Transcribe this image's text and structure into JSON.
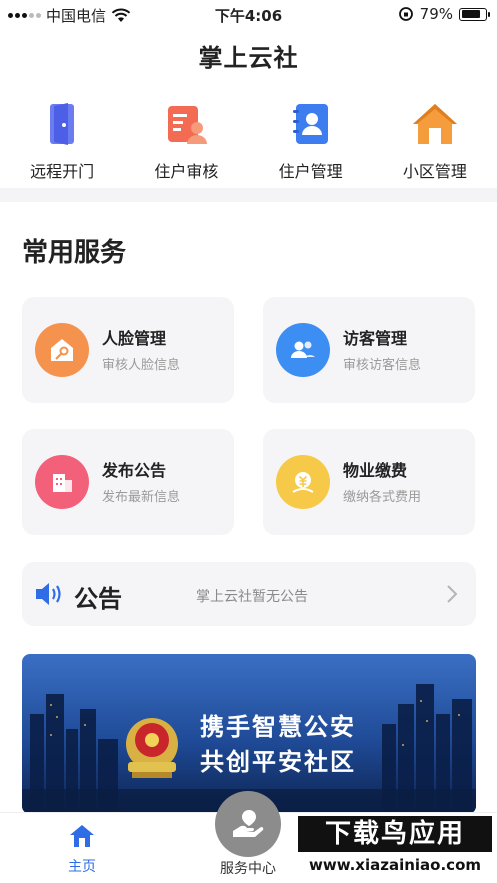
{
  "status_bar": {
    "carrier": "中国电信",
    "time": "下午4:06",
    "battery": "79%",
    "battery_level": 0.79
  },
  "app": {
    "title": "掌上云社"
  },
  "quick_nav": [
    {
      "label": "远程开门",
      "icon": "door-icon"
    },
    {
      "label": "住户审核",
      "icon": "resident-review-icon"
    },
    {
      "label": "住户管理",
      "icon": "contact-book-icon"
    },
    {
      "label": "小区管理",
      "icon": "house-icon"
    }
  ],
  "services": {
    "title": "常用服务",
    "items": [
      {
        "title": "人脸管理",
        "subtitle": "审核人脸信息",
        "icon": "face-key-icon",
        "color": "#f5934e"
      },
      {
        "title": "访客管理",
        "subtitle": "审核访客信息",
        "icon": "visitors-icon",
        "color": "#3d8ef2"
      },
      {
        "title": "发布公告",
        "subtitle": "发布最新信息",
        "icon": "building-icon",
        "color": "#f2607a"
      },
      {
        "title": "物业缴费",
        "subtitle": "缴纳各式费用",
        "icon": "payment-icon",
        "color": "#f7c948"
      }
    ]
  },
  "notice": {
    "title": "公告",
    "message": "掌上云社暂无公告"
  },
  "banner": {
    "line1": "携手智慧公安",
    "line2": "共创平安社区"
  },
  "tab_bar": {
    "home": "主页",
    "service_center": "服务中心"
  },
  "watermark": {
    "line1": "下载鸟应用",
    "line2": "www.xiazainiao.com"
  },
  "colors": {
    "accent": "#2f6ce6",
    "card_bg": "#f5f5f7"
  }
}
